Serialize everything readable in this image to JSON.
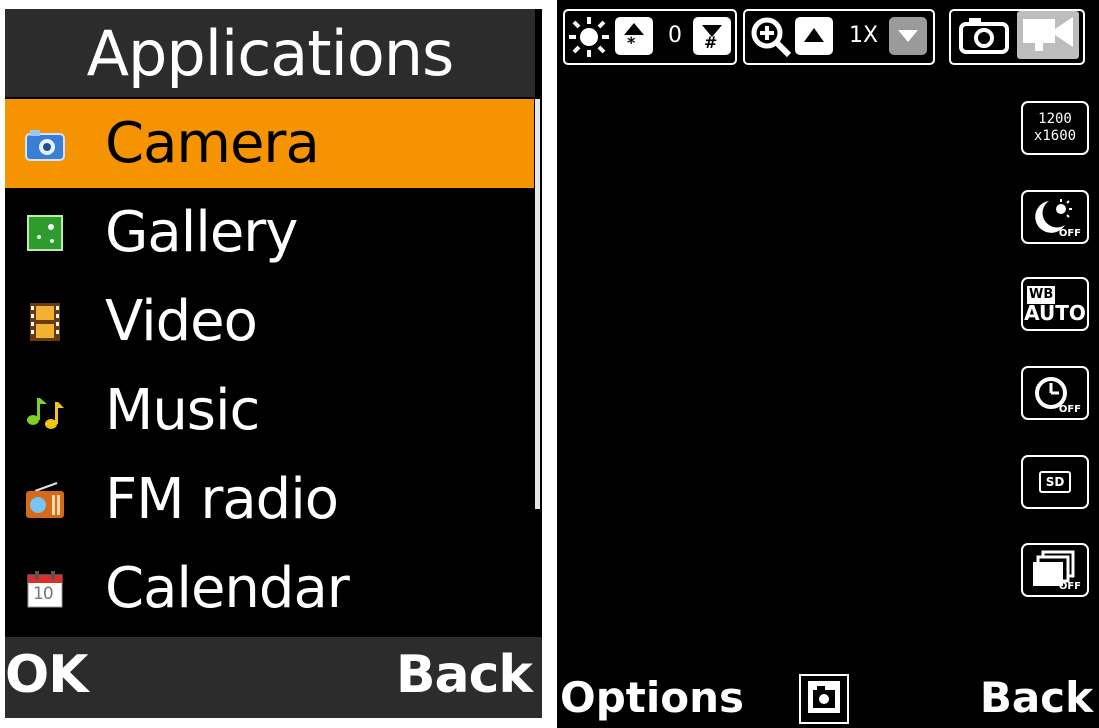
{
  "left": {
    "title": "Applications",
    "items": [
      {
        "label": "Camera",
        "icon": "camera-icon",
        "selected": true
      },
      {
        "label": "Gallery",
        "icon": "gallery-icon",
        "selected": false
      },
      {
        "label": "Video",
        "icon": "film-icon",
        "selected": false
      },
      {
        "label": "Music",
        "icon": "music-note-icon",
        "selected": false
      },
      {
        "label": "FM radio",
        "icon": "radio-icon",
        "selected": false
      },
      {
        "label": "Calendar",
        "icon": "calendar-icon",
        "selected": false
      }
    ],
    "calendar_day": "10",
    "softkeys": {
      "left": "OK",
      "right": "Back"
    },
    "colors": {
      "selection": "#f59300",
      "header": "#2c2c2c"
    }
  },
  "right": {
    "toolbar": {
      "brightness": {
        "value": "0",
        "up_key": "*",
        "down_key": "#"
      },
      "zoom": {
        "value": "1X"
      }
    },
    "side_settings": [
      {
        "name": "resolution",
        "text_line1": "1200",
        "text_line2": "x1600"
      },
      {
        "name": "night-mode",
        "status": "OFF"
      },
      {
        "name": "white-balance",
        "top": "WB",
        "value": "AUTO"
      },
      {
        "name": "self-timer",
        "status": "OFF"
      },
      {
        "name": "storage",
        "value": "SD"
      },
      {
        "name": "burst-mode",
        "status": "OFF"
      }
    ],
    "softkeys": {
      "left": "Options",
      "right": "Back"
    }
  }
}
